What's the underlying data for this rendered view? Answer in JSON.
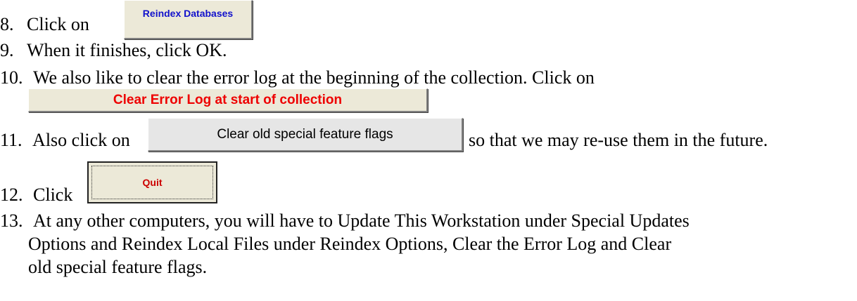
{
  "steps": [
    {
      "number": "8.",
      "text": "Click on"
    },
    {
      "number": "9.",
      "text": "When it finishes, click OK."
    },
    {
      "number": "10.",
      "text": "We also like to clear the error log at the beginning of the collection. Click on"
    },
    {
      "number": "11.",
      "text_before": "Also click on",
      "text_after": "so that we may re-use them in the future."
    },
    {
      "number": "12.",
      "text": "Click"
    },
    {
      "number": "13.",
      "line1": "At any other computers, you will have to Update This Workstation under Special Updates",
      "line2": "Options and Reindex Local Files under Reindex Options, Clear the Error Log and Clear",
      "line3": "old special feature flags."
    }
  ],
  "period_after_button": ".",
  "buttons": {
    "reindex": "Reindex Databases",
    "clear_error_log": "Clear Error Log at start of collection",
    "clear_flags": "Clear old special feature flags",
    "quit": "Quit"
  },
  "colors": {
    "reindex_text": "#1111cc",
    "error_log_text": "#ee0000",
    "quit_text": "#cc0000",
    "button_face": "#ece9d8"
  }
}
